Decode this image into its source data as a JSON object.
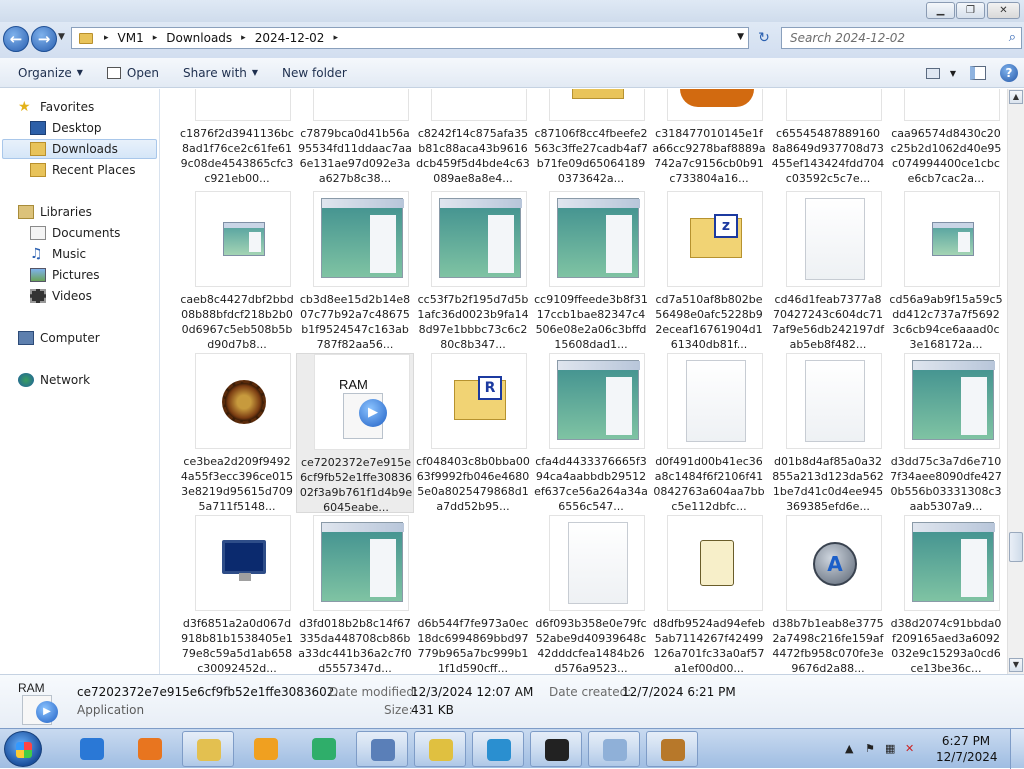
{
  "address": {
    "crumbs": [
      "VM1",
      "Downloads",
      "2024-12-02"
    ],
    "search_placeholder": "Search 2024-12-02"
  },
  "toolbar": {
    "organize": "Organize",
    "open": "Open",
    "share_with": "Share with",
    "new_folder": "New folder"
  },
  "nav": {
    "favorites": "Favorites",
    "desktop": "Desktop",
    "downloads": "Downloads",
    "recent": "Recent Places",
    "libraries": "Libraries",
    "documents": "Documents",
    "music": "Music",
    "pictures": "Pictures",
    "videos": "Videos",
    "computer": "Computer",
    "network": "Network"
  },
  "rows": [
    [
      {
        "icon": "blank",
        "name": "c1876f2d3941136bc8ad1f76ce2c61fe619c08de4543865cfc3c921eb00..."
      },
      {
        "icon": "blank",
        "name": "c7879bca0d41b56a95534fd11ddaac7aa6e131ae97d092e3aa627b8c38..."
      },
      {
        "icon": "blank",
        "name": "c8242f14c875afa35b81c88aca43b9616dcb459f5d4bde4c63089ae8a8e4..."
      },
      {
        "icon": "yellow",
        "name": "c87106f8cc4fbeefe2563c3ffe27cadb4af7b71fe09d650641890373642a..."
      },
      {
        "icon": "orange",
        "name": "c318477010145e1fa66cc9278baf8889a742a7c9156cb0b91c733804a16..."
      },
      {
        "icon": "blank",
        "name": "c65545487889160 8a8649d937708d73455ef143424fdd704c03592c5c7e..."
      },
      {
        "icon": "blank",
        "name": "caa96574d8430c20c25b2d1062d40e95c074994400ce1cbce6cb7cac2a..."
      }
    ],
    [
      {
        "icon": "exe-small",
        "name": "caeb8c4427dbf2bbd08b88bfdcf218b2b00d6967c5eb508b5bd90d7b8..."
      },
      {
        "icon": "exe-big",
        "name": "cb3d8ee15d2b14e807c77b92a7c48675b1f9524547c163ab787f82aa56..."
      },
      {
        "icon": "exe-big",
        "name": "cc53f7b2f195d7d5b1afc36d0023b9fa148d97e1bbbc73c6c280c8b347..."
      },
      {
        "icon": "exe-big",
        "name": "cc9109ffeede3b8f3117ccb1bae82347c4506e08e2a06c3bffd15608dad1..."
      },
      {
        "icon": "zip",
        "name": "cd7a510af8b802be56498e0afc5228b92eceaf16761904d161340db81f..."
      },
      {
        "icon": "blank-doc",
        "name": "cd46d1feab7377a870427243c604dc717af9e56db242197dfab5eb8f482..."
      },
      {
        "icon": "exe-small",
        "name": "cd56a9ab9f15a59c5dd412c737a7f56923c6cb94ce6aaad0c3e168172a..."
      }
    ],
    [
      {
        "icon": "gear",
        "name": "ce3bea2d209f94924a55f3ecc396ce0153e8219d95615d7095a711f5148..."
      },
      {
        "icon": "ram",
        "name": "ce7202372e7e915e6cf9fb52e1ffe3083602f3a9b761f1d4b9e6045eabe...",
        "selected": true
      },
      {
        "icon": "rar",
        "name": "cf048403c8b0bba0063f9992fb046e46805e0a8025479868d1a7dd52b95..."
      },
      {
        "icon": "exe-big",
        "name": "cfa4d4433376665f394ca4aabbdb29512ef637ce56a264a34a6556c547..."
      },
      {
        "icon": "blank-doc",
        "name": "d0f491d00b41ec36a8c1484f6f2106f410842763a604aa7bbc5e112dbfc..."
      },
      {
        "icon": "blank-doc",
        "name": "d01b8d4af85a0a32855a213d123da5621be7d41c0d4ee945369385efd6e..."
      },
      {
        "icon": "exe-big",
        "name": "d3dd75c3a7d6e7107f34aee8090dfe4270b556b03331308c3aab5307a9..."
      }
    ],
    [
      {
        "icon": "monitor",
        "name": "d3f6851a2a0d067d918b81b1538405e179e8c59a5d1ab658c30092452d..."
      },
      {
        "icon": "exe-big",
        "name": "d3fd018b2b8c14f67335da448708cb86ba33dc441b36a2c7f0d5557347d..."
      },
      {
        "icon": "none",
        "name": "d6b544f7fe973a0ec18dc6994869bbd97779b965a7bc999b11f1d590cff..."
      },
      {
        "icon": "blank-doc",
        "name": "d6f093b358e0e79fc52abe9d40939648c42dddcfea1484b26d576a9523..."
      },
      {
        "icon": "scroll",
        "name": "d8dfb9524ad94efeb5ab7114267f42499126a701fc33a0af57a1ef00d00..."
      },
      {
        "icon": "logoA",
        "name": "d38b7b1eab8e37752a7498c216fe159af4472fb958c070fe3e9676d2a88..."
      },
      {
        "icon": "exe-big",
        "name": "d38d2074c91bbda0f209165aed3a6092032e9c15293a0cd6ce13be36c..."
      }
    ]
  ],
  "details": {
    "name": "ce7202372e7e915e6cf9fb52e1ffe3083602...",
    "type": "Application",
    "modified_label": "Date modified:",
    "modified": "12/3/2024 12:07 AM",
    "created_label": "Date created:",
    "created": "12/7/2024 6:21 PM",
    "size_label": "Size:",
    "size": "431 KB",
    "icon_text": "RAM"
  },
  "clock": {
    "time": "6:27 PM",
    "date": "12/7/2024"
  },
  "taskbar": [
    "internet-explorer",
    "firefox",
    "file-explorer",
    "media-player",
    "browser-green",
    "network-tool",
    "tools",
    "search-tool",
    "7zip",
    "notepad",
    "app-gear"
  ]
}
